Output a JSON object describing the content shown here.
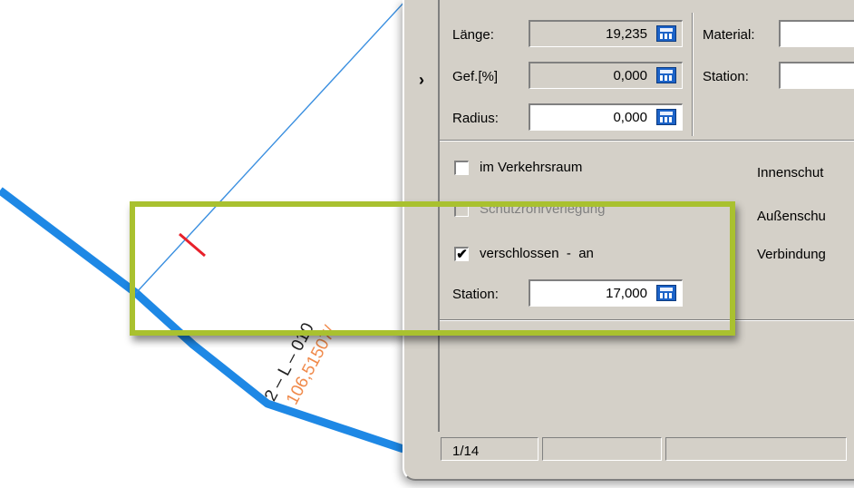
{
  "drawing": {
    "pipe_label_black": "2 ‒ L ‒ 010",
    "pipe_label_orange": "106,51507/",
    "colors": {
      "pipe": "#1e88e5",
      "thin_line": "#3a8fe0",
      "label_orange": "#f08a4b",
      "marker": "#e8202a",
      "highlight": "#a9c12f"
    }
  },
  "sidebar": {
    "toggle_icon": "chevron-right-icon",
    "toggle_glyph": "›"
  },
  "geometry_section": {
    "laenge": {
      "label": "Länge:",
      "value": "19,235"
    },
    "gefaelle": {
      "label": "Gef.[%]",
      "value": "0,000"
    },
    "radius": {
      "label": "Radius:",
      "value": "0,000"
    }
  },
  "right_section": {
    "material_label": "Material:",
    "station_label": "Station:"
  },
  "options": {
    "verkehrsraum": {
      "label": "im Verkehrsraum",
      "checked": false
    },
    "schutzrohr": {
      "label": "Schutzrohrverlegung",
      "checked": false
    },
    "verschlossen": {
      "label": "verschlossen  -  an",
      "checked": true,
      "glyph": "✔"
    },
    "station": {
      "label": "Station:",
      "value": "17,000"
    }
  },
  "right_labels": {
    "innenschutz": "Innenschut",
    "aussenschutz": "Außenschu",
    "verbindung": "Verbindung"
  },
  "statusbar": {
    "page": "1/14"
  }
}
